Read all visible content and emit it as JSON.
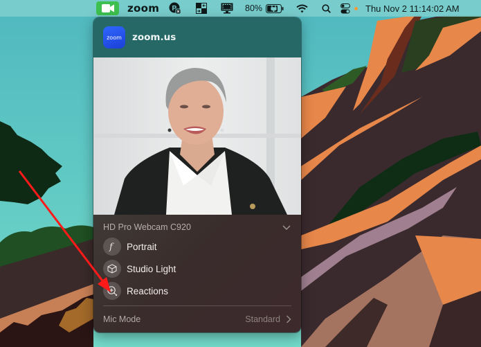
{
  "menubar": {
    "app_name": "zoom",
    "battery_percent": "80%",
    "clock": "Thu Nov 2  11:14:02 AM",
    "icons": [
      "video-camera-icon",
      "parking-app-icon",
      "window-switch-icon",
      "display-capture-icon",
      "battery-charging-icon",
      "wifi-icon",
      "spotlight-search-icon",
      "control-center-icon"
    ]
  },
  "popover": {
    "app_icon_text": "zoom",
    "app_name": "zoom.us",
    "camera_name": "HD Pro Webcam C920",
    "options": [
      {
        "label": "Portrait",
        "icon": "f-stop-icon"
      },
      {
        "label": "Studio Light",
        "icon": "cube-icon"
      },
      {
        "label": "Reactions",
        "icon": "reactions-icon"
      }
    ],
    "mic_mode_label": "Mic Mode",
    "mic_mode_value": "Standard"
  },
  "colors": {
    "accent_green": "#3dc04f",
    "header_teal": "#256866",
    "zoom_blue": "#2f67ff",
    "annotation_red": "#ff1a1a"
  }
}
